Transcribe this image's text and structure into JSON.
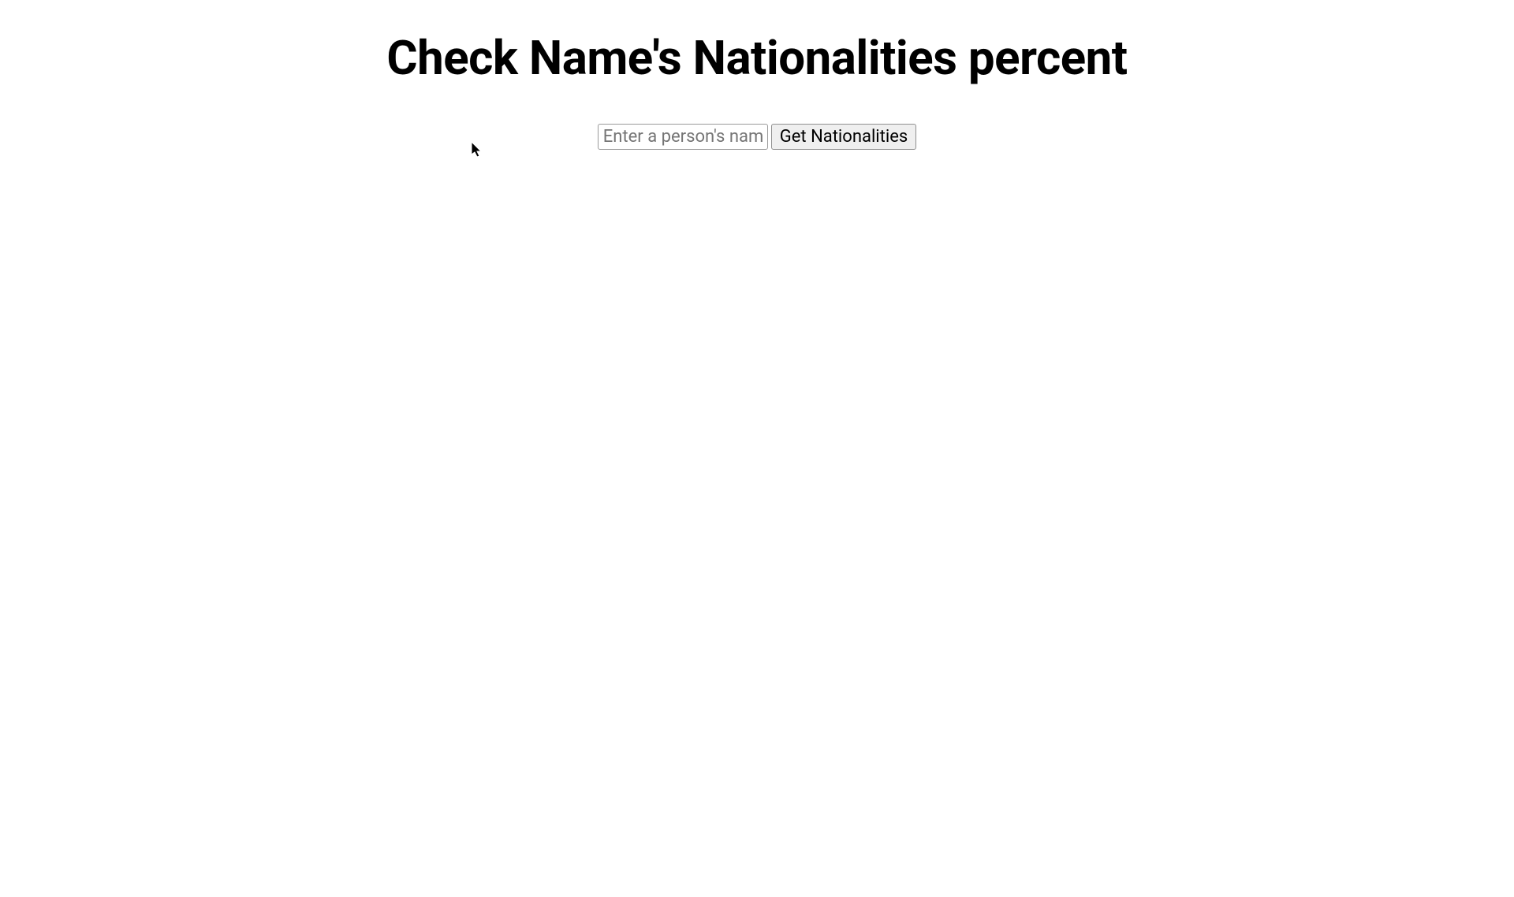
{
  "header": {
    "title": "Check Name's Nationalities percent"
  },
  "form": {
    "name_input": {
      "placeholder": "Enter a person's name",
      "value": ""
    },
    "submit_label": "Get Nationalities"
  }
}
